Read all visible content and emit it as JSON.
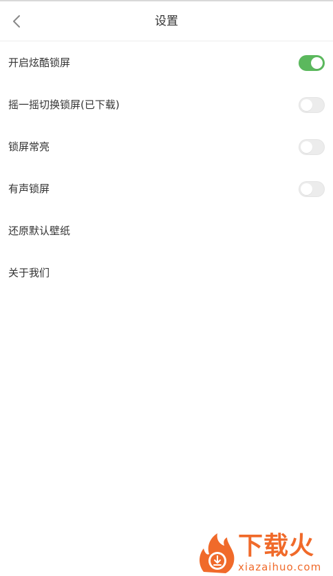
{
  "header": {
    "title": "设置",
    "back_icon": "chevron-left-icon"
  },
  "settings": [
    {
      "label": "开启炫酷锁屏",
      "toggle": true,
      "enabled": true
    },
    {
      "label": "摇一摇切换锁屏(已下载)",
      "toggle": true,
      "enabled": false
    },
    {
      "label": "锁屏常亮",
      "toggle": true,
      "enabled": false
    },
    {
      "label": "有声锁屏",
      "toggle": true,
      "enabled": false
    },
    {
      "label": "还原默认壁纸",
      "toggle": false
    },
    {
      "label": "关于我们",
      "toggle": false
    }
  ],
  "colors": {
    "toggle_on": "#5bb85d",
    "toggle_off": "#ececec",
    "text": "#333333",
    "watermark": "#f06a2a"
  },
  "watermark": {
    "brand": "下载火",
    "domain": "xiazaihuo.com"
  }
}
